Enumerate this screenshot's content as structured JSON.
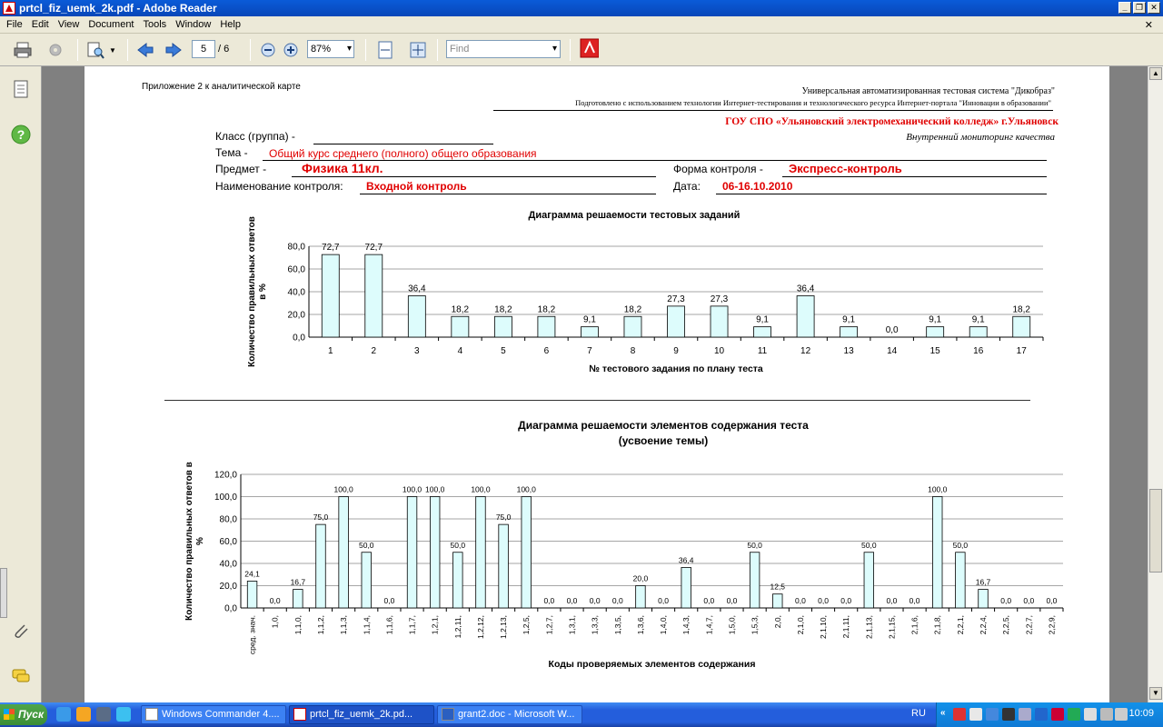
{
  "window": {
    "title": "prtcl_fiz_uemk_2k.pdf - Adobe Reader"
  },
  "menu": [
    "File",
    "Edit",
    "View",
    "Document",
    "Tools",
    "Window",
    "Help"
  ],
  "toolbar": {
    "page_current": "5",
    "page_total": "/ 6",
    "zoom": "87%",
    "find_placeholder": "Find"
  },
  "doc": {
    "appendix": "Приложение 2 к аналитической карте",
    "system_line": "Универсальная автоматизированная тестовая система \"Дикобраз\"",
    "prepared_line": "Подготовлено с использованием технологии Интернет-тестирования и технологического ресурса  Интернет-портала \"Инновации в образовании\"",
    "college": "ГОУ СПО «Ульяновский электромеханический колледж» г.Ульяновск",
    "monitoring": "Внутренний мониторинг  качества",
    "class_label": "Класс (группа) -",
    "topic_label": "Тема -",
    "topic_value": "Общий курс среднего (полного) общего образования",
    "subject_label": "Предмет  -",
    "subject_value": "Физика 11кл.",
    "form_label": "Форма контроля -",
    "form_value": "Экспресс-контроль",
    "control_label": "Наименование контроля:",
    "control_value": "Входной  контроль",
    "date_label": "Дата:",
    "date_value": "06-16.10.2010"
  },
  "chart_data": [
    {
      "type": "bar",
      "title": "Диаграмма решаемости тестовых заданий",
      "xlabel": "№ тестового задания по плану теста",
      "ylabel": "Количество правильных ответов в %",
      "ylim": [
        0,
        80
      ],
      "yticks": [
        "0,0",
        "20,0",
        "40,0",
        "60,0",
        "80,0"
      ],
      "grid": true,
      "categories": [
        "1",
        "2",
        "3",
        "4",
        "5",
        "6",
        "7",
        "8",
        "9",
        "10",
        "11",
        "12",
        "13",
        "14",
        "15",
        "16",
        "17"
      ],
      "values": [
        72.7,
        72.7,
        36.4,
        18.2,
        18.2,
        18.2,
        9.1,
        18.2,
        27.3,
        27.3,
        9.1,
        36.4,
        9.1,
        0.0,
        9.1,
        9.1,
        18.2
      ],
      "labels": [
        "72,7",
        "72,7",
        "36,4",
        "18,2",
        "18,2",
        "18,2",
        "9,1",
        "18,2",
        "27,3",
        "27,3",
        "9,1",
        "36,4",
        "9,1",
        "0,0",
        "9,1",
        "9,1",
        "18,2"
      ]
    },
    {
      "type": "bar",
      "title": "Диаграмма решаемости элементов содержания теста",
      "subtitle": "(усвоение темы)",
      "xlabel": "Коды проверяемых элементов содержания",
      "ylabel": "Количество правильных ответов в %",
      "ylim": [
        0,
        120
      ],
      "yticks": [
        "0,0",
        "20,0",
        "40,0",
        "60,0",
        "80,0",
        "100,0",
        "120,0"
      ],
      "grid": true,
      "categories": [
        "сред. знач.",
        "1,0,",
        "1,1,0,",
        "1,1,2,",
        "1,1,3,",
        "1,1,4,",
        "1,1,6,",
        "1,1,7,",
        "1,2,1,",
        "1,2,11,",
        "1,2,12,",
        "1,2,13,",
        "1,2,5,",
        "1,2,7,",
        "1,3,1,",
        "1,3,3,",
        "1,3,5,",
        "1,3,6,",
        "1,4,0,",
        "1,4,3,",
        "1,4,7,",
        "1,5,0,",
        "1,5,3,",
        "2,0,",
        "2,1,0,",
        "2,1,10,",
        "2,1,11,",
        "2,1,13,",
        "2,1,15,",
        "2,1,6,",
        "2,1,8,",
        "2,2,1,",
        "2,2,4,",
        "2,2,5,",
        "2,2,7,",
        "2,2,9,"
      ],
      "values": [
        24.1,
        0.0,
        16.7,
        75.0,
        100.0,
        50.0,
        0.0,
        100.0,
        100.0,
        50.0,
        100.0,
        75.0,
        100.0,
        0.0,
        0.0,
        0.0,
        0.0,
        20.0,
        0.0,
        36.4,
        0.0,
        0.0,
        50.0,
        12.5,
        0.0,
        0.0,
        0.0,
        50.0,
        0.0,
        0.0,
        100.0,
        50.0,
        16.7,
        0.0,
        0.0,
        0.0
      ],
      "labels": [
        "24,1",
        "0,0",
        "16,7",
        "75,0",
        "100,0",
        "50,0",
        "0,0",
        "100,0",
        "100,0",
        "50,0",
        "100,0",
        "75,0",
        "100,0",
        "0,0",
        "0,0",
        "0,0",
        "0,0",
        "20,0",
        "0,0",
        "36,4",
        "0,0",
        "0,0",
        "50,0",
        "12,5",
        "0,0",
        "0,0",
        "0,0",
        "50,0",
        "0,0",
        "0,0",
        "100,0",
        "50,0",
        "16,7",
        "0,0",
        "0,0",
        "0,0"
      ]
    }
  ],
  "taskbar": {
    "start": "Пуск",
    "tasks": [
      "Windows Commander 4....",
      "prtcl_fiz_uemk_2k.pd...",
      "grant2.doc - Microsoft W..."
    ],
    "lang": "RU",
    "clock": "10:09"
  }
}
